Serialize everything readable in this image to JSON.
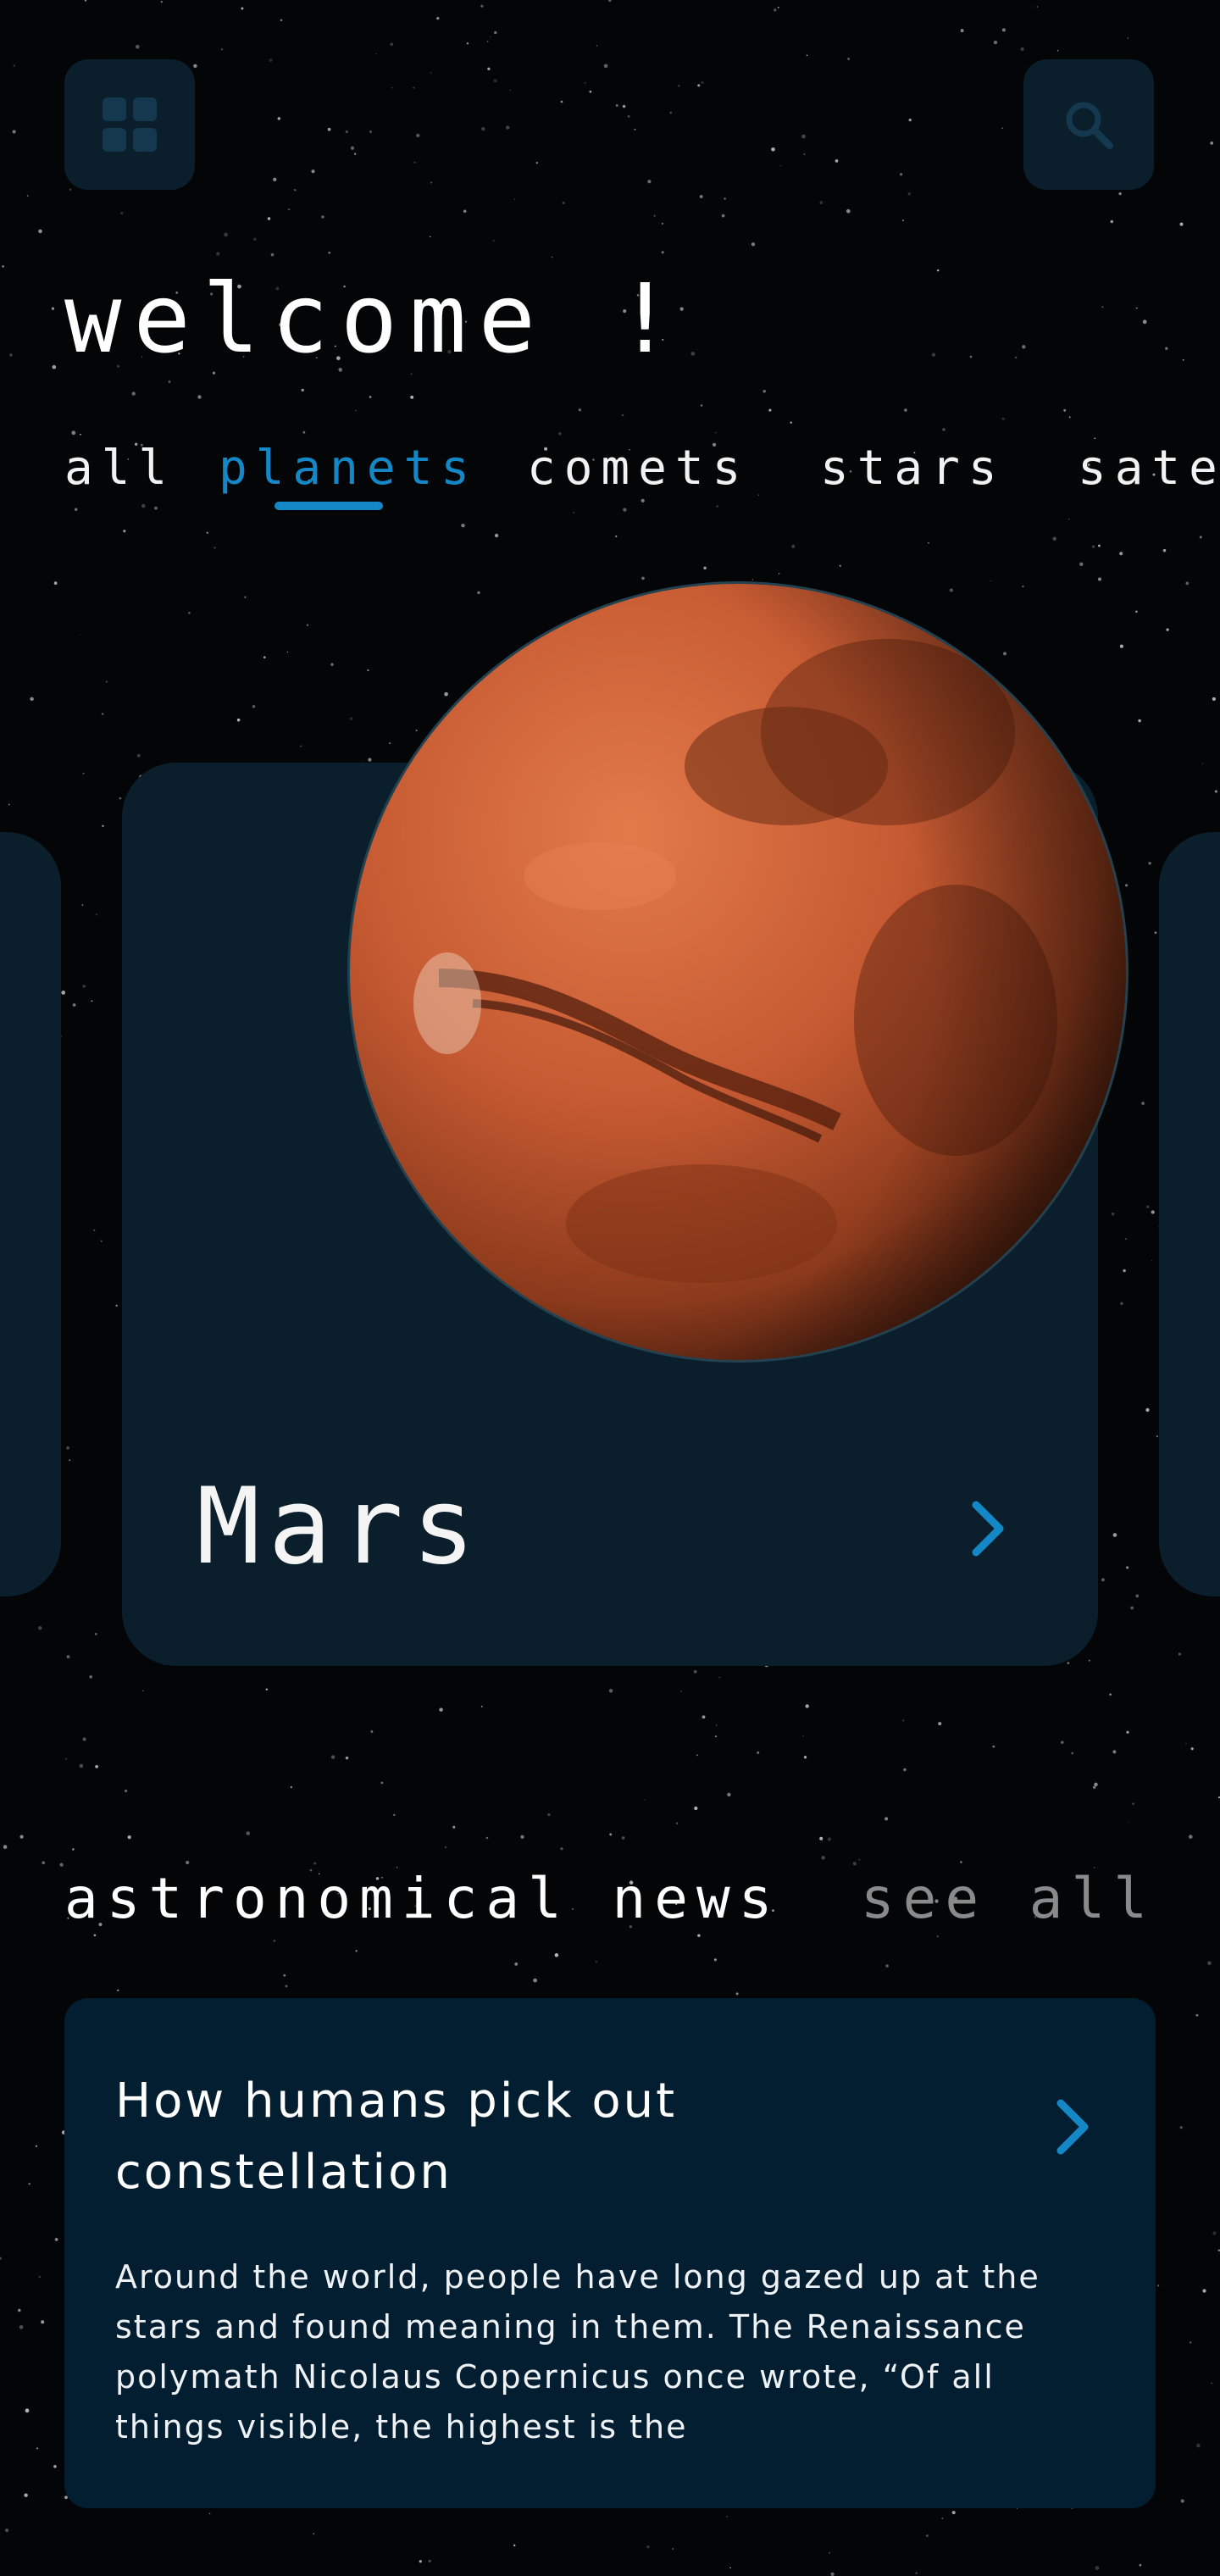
{
  "header": {
    "menu_icon": "grid-icon",
    "search_icon": "search-icon",
    "welcome": "welcome !"
  },
  "tabs": [
    {
      "label": "all",
      "active": false
    },
    {
      "label": "planets",
      "active": true
    },
    {
      "label": "comets",
      "active": false
    },
    {
      "label": "stars",
      "active": false
    },
    {
      "label": "satel",
      "active": false
    }
  ],
  "featured": {
    "name": "Mars",
    "chevron_icon": "chevron-right-icon"
  },
  "news_section": {
    "title": "astronomical news",
    "see_all": "see all",
    "articles": [
      {
        "title": "How humans pick out constellation",
        "body": "Around the world, people have long gazed up at the stars and found meaning in them. The Renaissance polymath Nicolaus Copernicus once wrote, “Of all things visible, the highest is the",
        "chevron_icon": "chevron-right-icon"
      }
    ]
  },
  "colors": {
    "background": "#040507",
    "card": "#0a1f2b",
    "news_card": "#041e31",
    "accent": "#1488c6",
    "muted": "#8a8a8a",
    "planet": "#c65a32"
  }
}
